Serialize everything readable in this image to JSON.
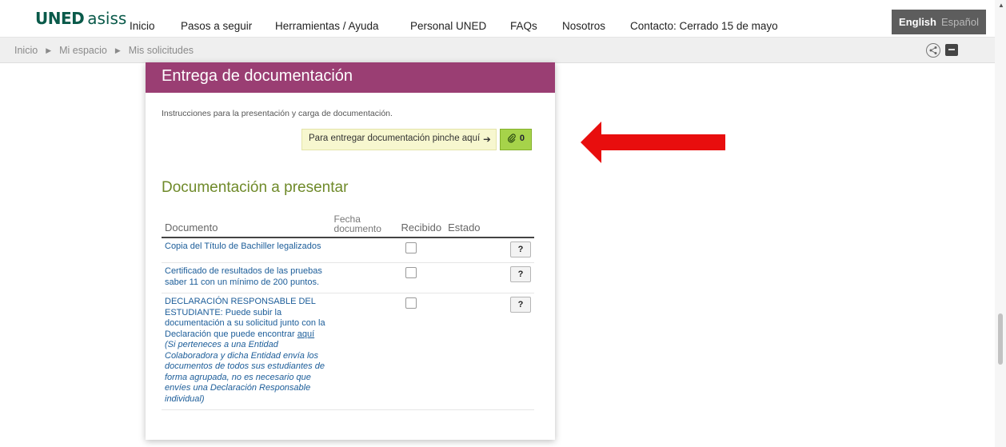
{
  "brand": {
    "uned": "UNED",
    "asiss": "asiss"
  },
  "nav": {
    "items": [
      "Inicio",
      "Pasos a seguir",
      "Herramientas / Ayuda",
      "Personal UNED",
      "FAQs",
      "Nosotros",
      "Contacto: Cerrado 15 de mayo"
    ]
  },
  "language": {
    "active": "English",
    "inactive": "Español"
  },
  "breadcrumb": {
    "items": [
      "Inicio",
      "Mi espacio",
      "Mis solicitudes"
    ]
  },
  "card": {
    "title": "Entrega de documentación",
    "instructions": "Instrucciones para la presentación y carga de documentación.",
    "deliver_label": "Para entregar documentación pinche aquí",
    "deliver_count": "0"
  },
  "section_title": "Documentación a presentar",
  "table": {
    "headers": {
      "documento": "Documento",
      "fecha_1": "Fecha",
      "fecha_2": "documento",
      "recibido": "Recibido",
      "estado": "Estado"
    },
    "rows": [
      {
        "documento": "Copia del Título de Bachiller legalizados",
        "help": "?"
      },
      {
        "documento": "Certificado de resultados de las pruebas saber 11 con un mínimo de 200 puntos.",
        "help": "?"
      },
      {
        "documento_part1": "DECLARACIÓN RESPONSABLE DEL ESTUDIANTE: Puede subir la documentación a su solicitud junto con la Declaración que puede encontrar ",
        "documento_link": "aquí",
        "documento_note": "(Si perteneces a una Entidad Colaboradora y dicha Entidad envía los documentos de todos sus estudiantes de forma agrupada, no es necesario que envíes una Declaración Responsable individual)",
        "help": "?"
      }
    ]
  },
  "colors": {
    "brand": "#0a5a4a",
    "card_header": "#9a3e73",
    "section_title": "#6f8a2a",
    "deliver_button": "#a6d34a",
    "arrow": "#e80e0e"
  },
  "icons": [
    "share-icon",
    "grid-icon",
    "arrow-right-icon",
    "paperclip-icon",
    "red-arrow-icon"
  ]
}
